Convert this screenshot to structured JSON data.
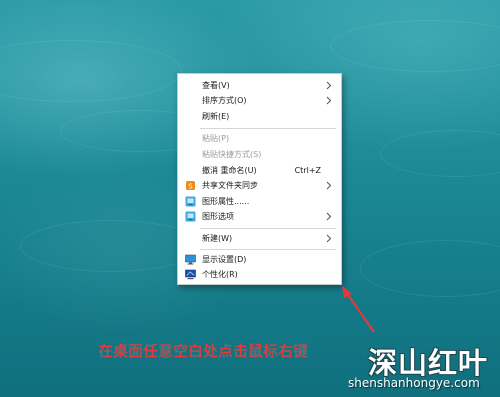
{
  "context_menu": {
    "items": [
      {
        "label": "查看(V)",
        "submenu": true
      },
      {
        "label": "排序方式(O)",
        "submenu": true
      },
      {
        "label": "刷新(E)"
      },
      {
        "label": "粘贴(P)",
        "disabled": true
      },
      {
        "label": "粘贴快捷方式(S)",
        "disabled": true
      },
      {
        "label": "撤消 重命名(U)",
        "shortcut": "Ctrl+Z"
      },
      {
        "label": "共享文件夹同步",
        "submenu": true,
        "icon": "share-sync-icon"
      },
      {
        "label": "图形属性......",
        "icon": "graphics-properties-icon"
      },
      {
        "label": "图形选项",
        "submenu": true,
        "icon": "graphics-options-icon"
      },
      {
        "label": "新建(W)",
        "submenu": true
      },
      {
        "label": "显示设置(D)",
        "icon": "display-settings-icon"
      },
      {
        "label": "个性化(R)",
        "icon": "personalize-icon"
      }
    ]
  },
  "caption": "在桌面任意空白处点击鼠标右键",
  "watermark": {
    "name": "深山红叶",
    "url": "shenshanhongye.com"
  },
  "colors": {
    "caption": "#e8383a",
    "desktop": "#1f8d9a"
  }
}
